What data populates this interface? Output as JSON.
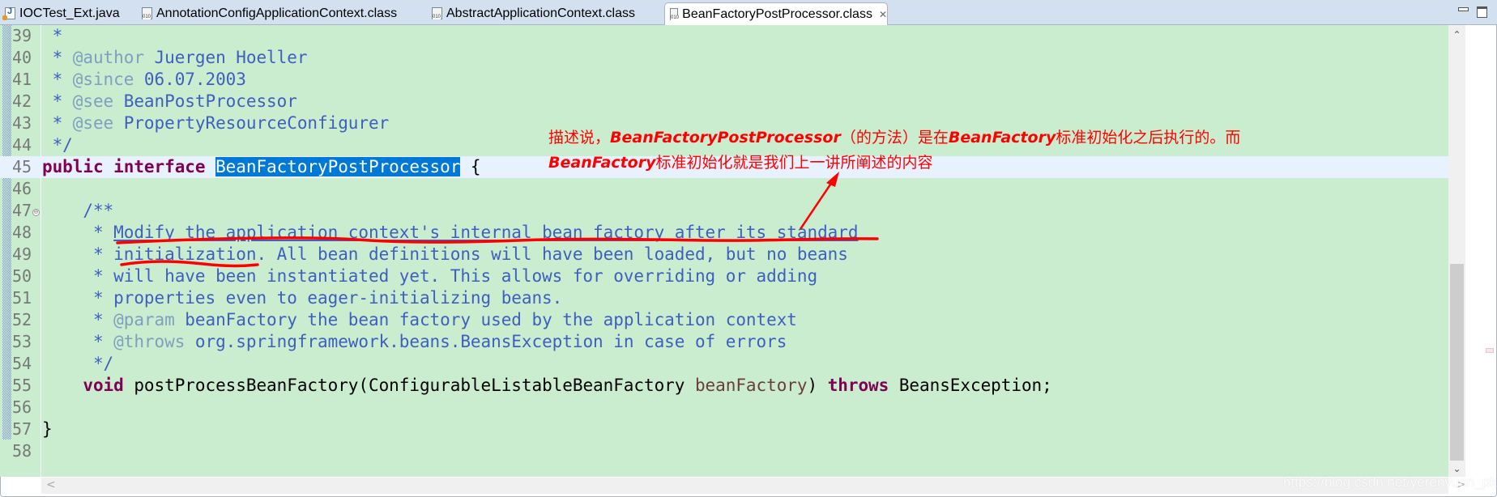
{
  "tabs": [
    {
      "label": "IOCTest_Ext.java",
      "icon": "java-file-icon",
      "active": false
    },
    {
      "label": "AnnotationConfigApplicationContext.class",
      "icon": "class-file-icon",
      "active": false
    },
    {
      "label": "AbstractApplicationContext.class",
      "icon": "class-file-icon",
      "active": false
    },
    {
      "label": "BeanFactoryPostProcessor.class",
      "icon": "class-file-icon",
      "active": true,
      "close": "✕"
    }
  ],
  "window_controls": {
    "minimize": "minimize",
    "maximize": "maximize"
  },
  "editor": {
    "lines": [
      {
        "n": "39",
        "text": " *"
      },
      {
        "n": "40",
        "star": " * ",
        "tag": "@author",
        "rest": " Juergen Hoeller"
      },
      {
        "n": "41",
        "star": " * ",
        "tag": "@since",
        "rest": " 06.07.2003"
      },
      {
        "n": "42",
        "star": " * ",
        "tag": "@see",
        "rest": " BeanPostProcessor"
      },
      {
        "n": "43",
        "star": " * ",
        "tag": "@see",
        "rest": " PropertyResourceConfigurer"
      },
      {
        "n": "44",
        "text": " */"
      },
      {
        "n": "45",
        "kw1": "public",
        "kw2": "interface",
        "name": "BeanFactoryPostProcessor",
        "rest": " {"
      },
      {
        "n": "46",
        "text": ""
      },
      {
        "n": "47",
        "text": "    /**",
        "fold": "⊖"
      },
      {
        "n": "48",
        "star": "     * ",
        "link": "Modify the application context's internal bean factory after its standard"
      },
      {
        "n": "49",
        "text": "     * initialization. All bean definitions will have been loaded, but no beans"
      },
      {
        "n": "50",
        "text": "     * will have been instantiated yet. This allows for overriding or adding"
      },
      {
        "n": "51",
        "text": "     * properties even to eager-initializing beans."
      },
      {
        "n": "52",
        "star": "     * ",
        "tag": "@param",
        "rest": " beanFactory the bean factory used by the application context"
      },
      {
        "n": "53",
        "star": "     * ",
        "tag": "@throws",
        "rest": " org.springframework.beans.BeansException in case of errors"
      },
      {
        "n": "54",
        "text": "     */"
      },
      {
        "n": "55",
        "indent": "    ",
        "kw_void": "void",
        "sig": " postProcessBeanFactory(ConfigurableListableBeanFactory ",
        "param": "beanFactory",
        "close": ") ",
        "kw_throws": "throws",
        "exc": " BeansException;"
      },
      {
        "n": "56",
        "text": ""
      },
      {
        "n": "57",
        "text": "}"
      },
      {
        "n": "58",
        "text": ""
      }
    ],
    "current_line": "45"
  },
  "annotation": {
    "line1_a": "描述说，",
    "line1_b": "BeanFactoryPostProcessor",
    "line1_c": "（的方法）是在",
    "line1_d": "BeanFactory",
    "line1_e": "标准初始化之后执行的。而",
    "line2_a": "BeanFactory",
    "line2_b": "标准初始化就是我们上一讲所阐述的内容",
    "color": "#ff0000"
  },
  "scroll": {
    "up": "⌃",
    "down": "⌄",
    "left": "<",
    "right": ">"
  },
  "watermark": "https://blog.csdn.net/yerenyuan_pku"
}
